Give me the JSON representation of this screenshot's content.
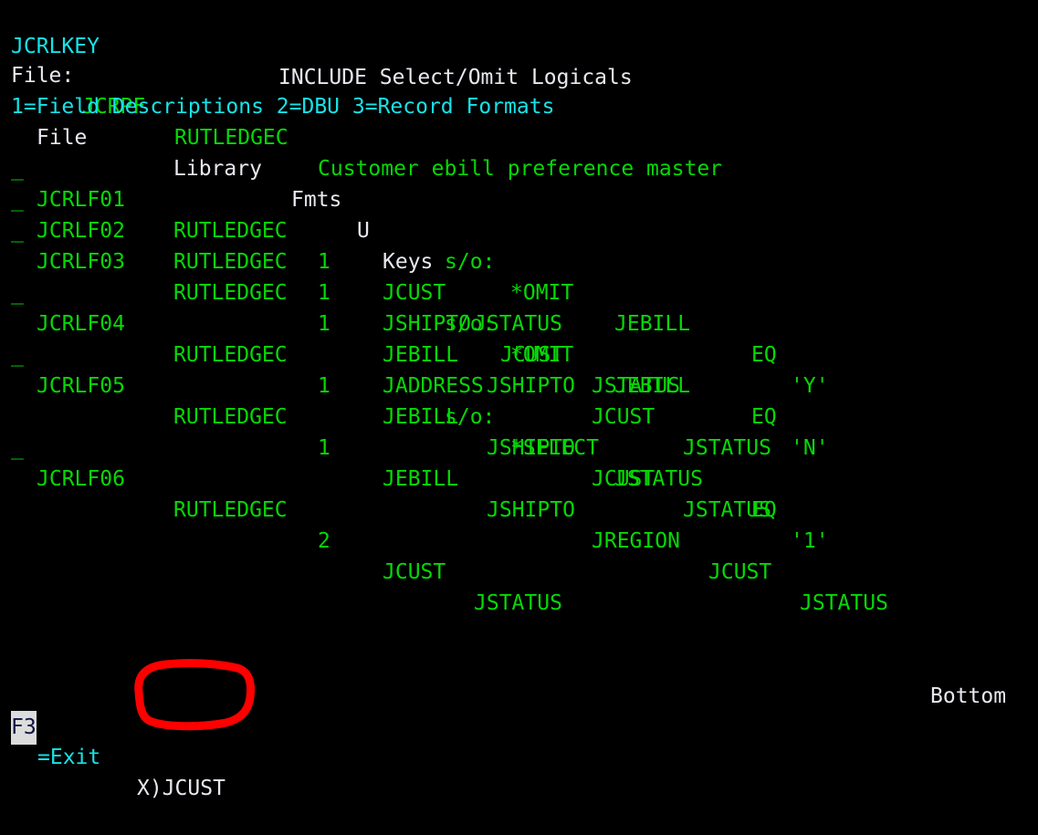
{
  "screen": {
    "background_color": "#000000",
    "colors": {
      "cyan": "#16e3e8",
      "green": "#06d806",
      "white": "#e8e8f0",
      "annotation_red": "#ff0000",
      "highlight_bg": "#dcdcdc"
    }
  },
  "header": {
    "program_id": "JCRLKEY",
    "title": "INCLUDE Select/Omit Logicals",
    "file_label": "File:",
    "file_name": "JCRPF",
    "file_library": "RUTLEDGEC",
    "file_text": "Customer ebill preference master",
    "options": "1=Field Descriptions 2=DBU 3=Record Formats"
  },
  "table": {
    "columns": [
      "File",
      "Library",
      "Fmts",
      "U",
      "Keys"
    ],
    "rows": [
      {
        "opt": "_",
        "file": "JCRLF01",
        "library": "RUTLEDGEC",
        "fmts": "1",
        "u": "",
        "keys": [
          "JCUST",
          "JSTATUS"
        ],
        "keys_line2": "",
        "so": null
      },
      {
        "opt": "_",
        "file": "JCRLF02",
        "library": "RUTLEDGEC",
        "fmts": "1",
        "u": "",
        "keys": [
          "JSHIPTO",
          "JCUST",
          "JSTATUS"
        ],
        "keys_line2": "",
        "so": null
      },
      {
        "opt": "_",
        "file": "JCRLF03",
        "library": "RUTLEDGEC",
        "fmts": "1",
        "u": "",
        "keys": [
          "JEBILL",
          "JSHIPTO",
          "JCUST",
          "JSTATUS"
        ],
        "keys_line2": "",
        "so": {
          "label": "s/o:",
          "type": "*OMIT",
          "field": "JEBILL",
          "operator": "EQ",
          "value": "'Y'"
        }
      },
      {
        "opt": "_",
        "file": "JCRLF04",
        "library": "RUTLEDGEC",
        "fmts": "1",
        "u": "",
        "keys": [
          "JEBILL",
          "JSHIPTO",
          "JCUST",
          "JSTATUS"
        ],
        "keys_line2": "",
        "so": {
          "label": "s/o:",
          "type": "*OMIT",
          "field": "JEBILL",
          "operator": "EQ",
          "value": "'N'"
        }
      },
      {
        "opt": "_",
        "file": "JCRLF05",
        "library": "RUTLEDGEC",
        "fmts": "1",
        "u": "",
        "keys": [
          "JEBILL",
          "JSHIPTO",
          "JREGION",
          "JCUST",
          "JSTATUS"
        ],
        "keys_line2": "JADDRESS",
        "so": {
          "label": "s/o:",
          "type": "*SELECT",
          "field": "JSTATUS",
          "operator": "EQ",
          "value": "'1'"
        }
      },
      {
        "opt": "_",
        "file": "JCRLF06",
        "library": "RUTLEDGEC",
        "fmts": "2",
        "u": "",
        "keys": [
          "JCUST",
          "JSTATUS"
        ],
        "keys_line2": "",
        "so": null
      }
    ]
  },
  "footer": {
    "position_indicator": "Bottom",
    "fkey_label": "F3",
    "fkey_text": "=Exit",
    "note": "X)JCUST"
  },
  "text_lines": {
    "l01": "JCRLKEY              INCLUDE Select/Omit Logicals",
    "l02": "File: JCRPF  RUTLEDGEC  Customer ebill preference master",
    "l03": "1=Field Descriptions 2=DBU 3=Record Formats",
    "l04": "  File        Library  Fmts U Keys",
    "l05": "_ JCRLF01     RUTLEDGEC  1    JCUST  JSTATUS",
    "l06": "_ JCRLF02     RUTLEDGEC  1    JSHIPTO  JCUST  JSTATUS",
    "l07": "_ JCRLF03     RUTLEDGEC  1    JEBILL  JSHIPTO  JCUST  JSTATUS",
    "l08": "                              s/o: *OMIT   JEBILL    EQ 'Y'",
    "l09": "_ JCRLF04     RUTLEDGEC  1    JEBILL  JSHIPTO  JCUST  JSTATUS",
    "l10": "                              s/o: *OMIT   JEBILL    EQ 'N'",
    "l11": "_ JCRLF05     RUTLEDGEC  1    JEBILL  JSHIPTO  JREGION  JCUST  JSTATUS",
    "l12": "                              JADDRESS",
    "l13": "                              s/o: *SELECT JSTATUS   EQ '1'",
    "l14": "_ JCRLF06     RUTLEDGEC  2    JCUST  JSTATUS"
  }
}
